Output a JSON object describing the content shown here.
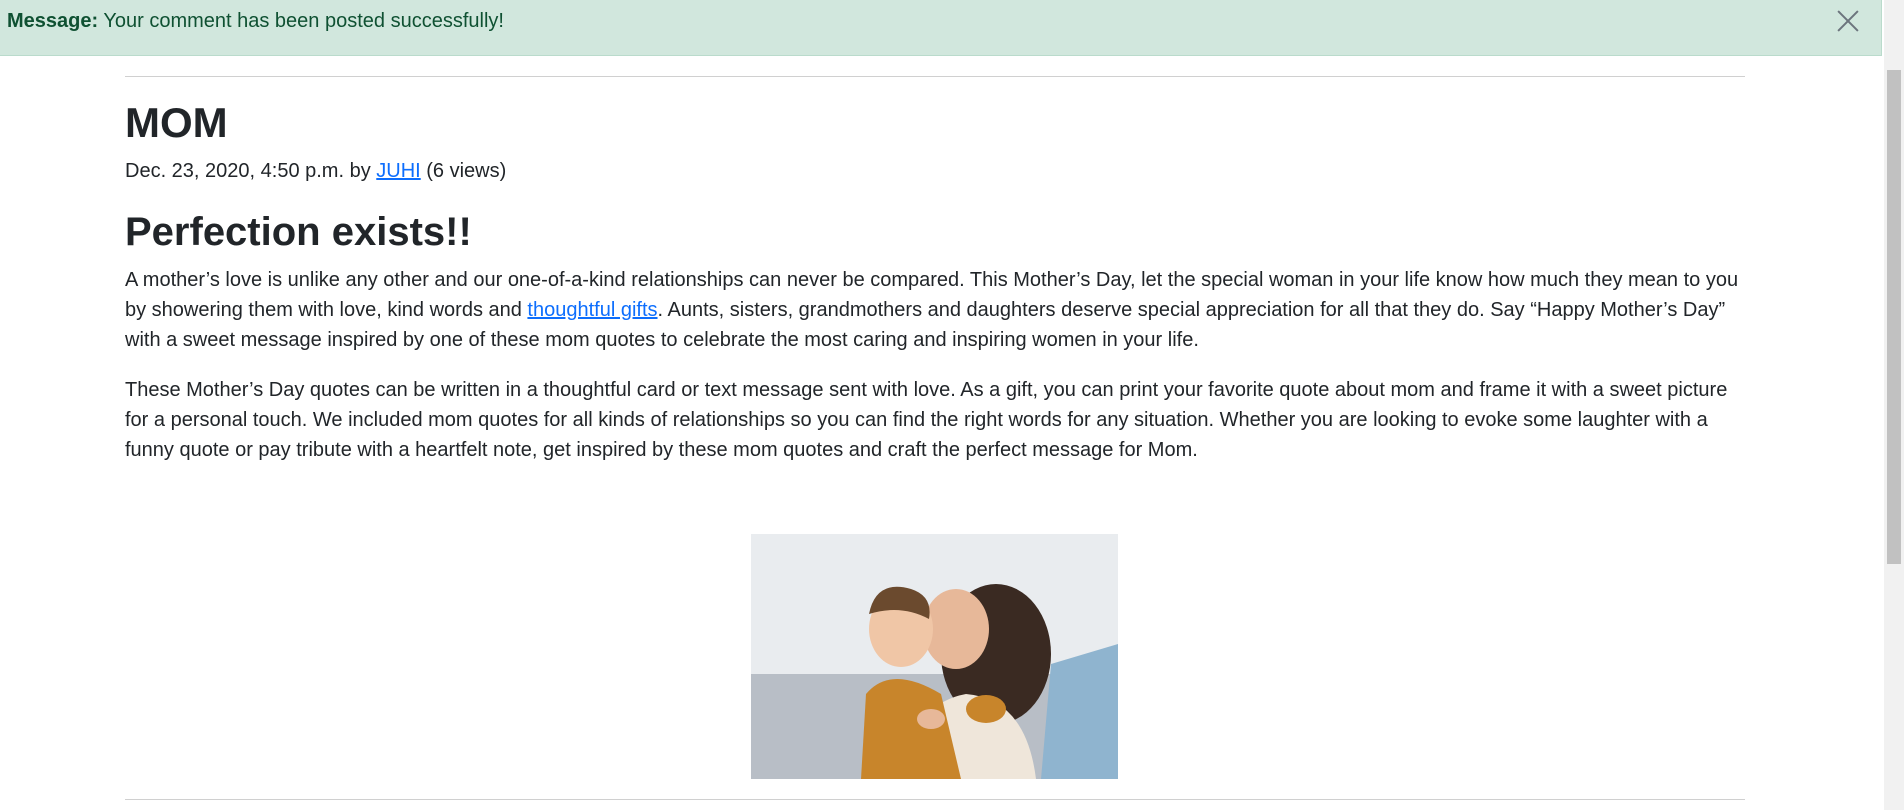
{
  "alert": {
    "label": "Message:",
    "text": " Your comment has been posted successfully!",
    "close_icon": "close-icon"
  },
  "post": {
    "title": "MOM",
    "meta_date": "Dec. 23, 2020, 4:50 p.m. by ",
    "author": "JUHI",
    "views": " (6 views)",
    "headline": "Perfection exists!!",
    "p1_before": "A mother’s love is unlike any other and our one-of-a-kind relationships can never be compared. This Mother’s Day, let the special woman in your life know how much they mean to you by showering them with love, kind words and ",
    "p1_link": "thoughtful gifts",
    "p1_after": ". Aunts, sisters, grandmothers and daughters deserve special appreciation for all that they do. Say “Happy Mother’s Day” with a sweet message inspired by one of these mom quotes to celebrate the most caring and inspiring women in your life.",
    "p2": "These Mother’s Day quotes can be written in a thoughtful card or text message sent with love. As a gift, you can print your favorite quote about mom and frame it with a sweet picture for a personal touch. We included mom quotes for all kinds of relationships so you can find the right words for any situation. Whether you are looking to evoke some laughter with a funny quote or pay tribute with a heartfelt note, get inspired by these mom quotes and craft the perfect message for Mom."
  },
  "colors": {
    "alert_bg": "#d1e7dd",
    "alert_text": "#0f5132",
    "link": "#0d6efd",
    "text": "#212529"
  }
}
